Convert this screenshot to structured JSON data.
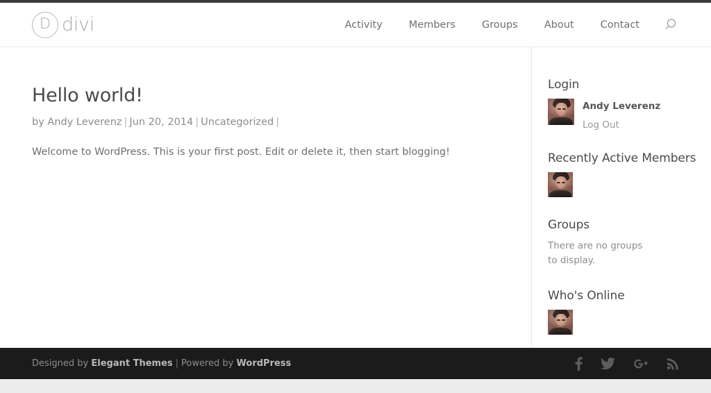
{
  "header": {
    "logo": {
      "mark": "D",
      "text": "divi",
      "icon": "divi-logo-icon"
    },
    "nav": [
      {
        "label": "Activity"
      },
      {
        "label": "Members"
      },
      {
        "label": "Groups"
      },
      {
        "label": "About"
      },
      {
        "label": "Contact"
      }
    ],
    "search_icon": "search-icon"
  },
  "post": {
    "title": "Hello world!",
    "meta": {
      "by_prefix": "by ",
      "author": "Andy Leverenz",
      "date": "Jun 20, 2014",
      "category": "Uncategorized",
      "separator": "|"
    },
    "body": "Welcome to WordPress. This is your first post. Edit or delete it, then start blogging!"
  },
  "sidebar": {
    "login": {
      "title": "Login",
      "user_name": "Andy Leverenz",
      "logout_label": "Log Out",
      "avatar_alt": "Andy Leverenz avatar"
    },
    "recently_active": {
      "title": "Recently Active Members",
      "avatar_alt": "Andy Leverenz avatar"
    },
    "groups": {
      "title": "Groups",
      "empty_text": "There are no groups to display."
    },
    "whos_online": {
      "title": "Who's Online",
      "avatar_alt": "Andy Leverenz avatar"
    }
  },
  "footer": {
    "designed_by": "Designed by ",
    "designer": "Elegant Themes",
    "separator": "|",
    "powered_by": "Powered by ",
    "platform": "WordPress",
    "social": [
      {
        "name": "facebook-icon",
        "glyph": "f"
      },
      {
        "name": "twitter-icon",
        "glyph": "t"
      },
      {
        "name": "google-plus-icon",
        "glyph": "g+"
      },
      {
        "name": "rss-icon",
        "glyph": "rss"
      }
    ]
  },
  "colors": {
    "footer_bg": "#1b1b1b",
    "text": "#6f6f6f",
    "heading": "#4a4a4a",
    "divider": "#e8e8e8"
  }
}
